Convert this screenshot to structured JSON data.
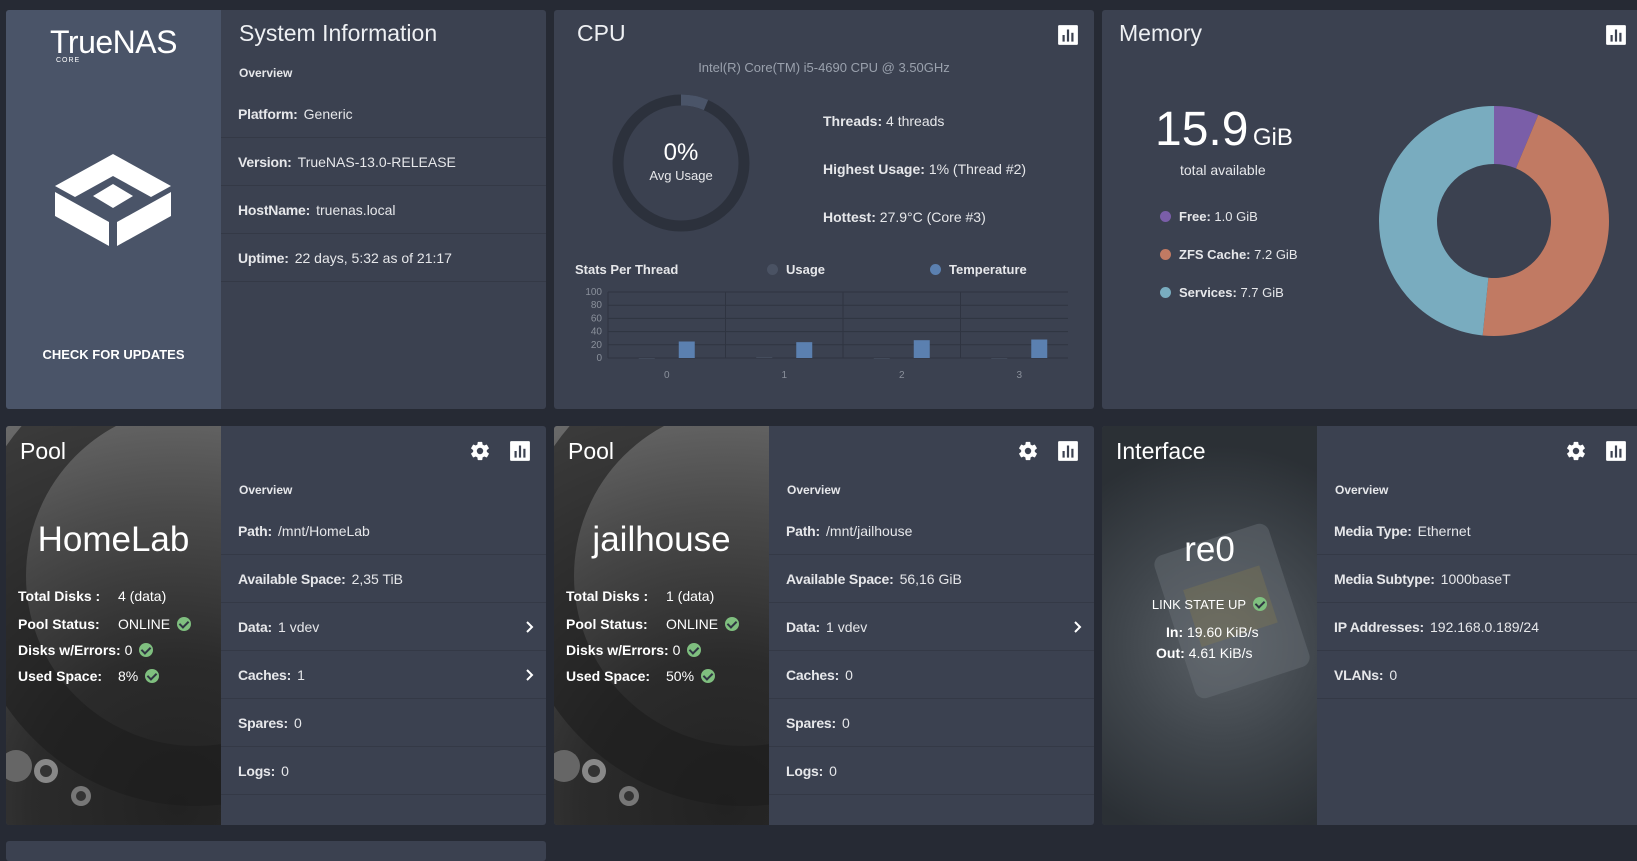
{
  "colors": {
    "card": "#3b4150",
    "accent_blue": "#5b80b0",
    "ok_green": "#7fbf7f",
    "free": "#7a5ea8",
    "zfs_cache": "#c17a63",
    "services": "#79acbf"
  },
  "sysinfo": {
    "brand": "TrueNAS",
    "brand_sub": "CORE",
    "check_updates": "CHECK FOR UPDATES",
    "title": "System Information",
    "overview": "Overview",
    "rows": [
      {
        "label": "Platform:",
        "value": "Generic"
      },
      {
        "label": "Version:",
        "value": "TrueNAS-13.0-RELEASE"
      },
      {
        "label": "HostName:",
        "value": "truenas.local"
      },
      {
        "label": "Uptime:",
        "value": "22 days, 5:32 as of 21:17"
      }
    ]
  },
  "cpu": {
    "title": "CPU",
    "model": "Intel(R) Core(TM) i5-4690 CPU @ 3.50GHz",
    "avg_value": "0%",
    "avg_label": "Avg Usage",
    "stats": [
      {
        "label": "Threads:",
        "value": "4 threads"
      },
      {
        "label": "Highest Usage:",
        "value": "1%  (Thread #2)"
      },
      {
        "label": "Hottest:",
        "value": "27.9°C  (Core #3)"
      }
    ],
    "stats_per_thread": "Stats Per Thread",
    "legend_usage": "Usage",
    "legend_temp": "Temperature"
  },
  "chart_data": {
    "type": "bar",
    "categories": [
      "0",
      "1",
      "2",
      "3"
    ],
    "series": [
      {
        "name": "Usage",
        "values": [
          0,
          1,
          0,
          0
        ],
        "color": "#4a5263"
      },
      {
        "name": "Temperature",
        "values": [
          25,
          24,
          27,
          28
        ],
        "color": "#5b80b0"
      }
    ],
    "yticks": [
      "100",
      "80",
      "60",
      "40",
      "20",
      "0"
    ],
    "ylim": [
      0,
      100
    ],
    "grid": true
  },
  "memory": {
    "title": "Memory",
    "total_value": "15.9",
    "total_unit": "GiB",
    "total_label": "total available",
    "legend": [
      {
        "label": "Free:",
        "value": "1.0 GiB",
        "gib": 1.0,
        "color": "#7a5ea8"
      },
      {
        "label": "ZFS Cache:",
        "value": "7.2 GiB",
        "gib": 7.2,
        "color": "#c17a63"
      },
      {
        "label": "Services:",
        "value": "7.7 GiB",
        "gib": 7.7,
        "color": "#79acbf"
      }
    ]
  },
  "pools": [
    {
      "title": "Pool",
      "name": "HomeLab",
      "total_disks_label": "Total Disks :",
      "total_disks": "4 (data)",
      "status_label": "Pool Status:",
      "status": "ONLINE",
      "errors_label": "Disks w/Errors:",
      "errors": "0",
      "used_label": "Used Space:",
      "used": "8%",
      "overview": "Overview",
      "rows": [
        {
          "label": "Path:",
          "value": "/mnt/HomeLab"
        },
        {
          "label": "Available Space:",
          "value": "2,35 TiB"
        },
        {
          "label": "Data:",
          "value": "1 vdev"
        },
        {
          "label": "Caches:",
          "value": "1"
        },
        {
          "label": "Spares:",
          "value": "0"
        },
        {
          "label": "Logs:",
          "value": "0"
        }
      ]
    },
    {
      "title": "Pool",
      "name": "jailhouse",
      "total_disks_label": "Total Disks :",
      "total_disks": "1 (data)",
      "status_label": "Pool Status:",
      "status": "ONLINE",
      "errors_label": "Disks w/Errors:",
      "errors": "0",
      "used_label": "Used Space:",
      "used": "50%",
      "overview": "Overview",
      "rows": [
        {
          "label": "Path:",
          "value": "/mnt/jailhouse"
        },
        {
          "label": "Available Space:",
          "value": "56,16 GiB"
        },
        {
          "label": "Data:",
          "value": "1 vdev"
        },
        {
          "label": "Caches:",
          "value": "0"
        },
        {
          "label": "Spares:",
          "value": "0"
        },
        {
          "label": "Logs:",
          "value": "0"
        }
      ]
    }
  ],
  "interface": {
    "title": "Interface",
    "name": "re0",
    "link_state": "LINK STATE UP",
    "in_label": "In:",
    "in_value": "19.60 KiB/s",
    "out_label": "Out:",
    "out_value": "4.61 KiB/s",
    "overview": "Overview",
    "rows": [
      {
        "label": "Media Type:",
        "value": "Ethernet"
      },
      {
        "label": "Media Subtype:",
        "value": "1000baseT"
      },
      {
        "label": "IP Addresses:",
        "value": "192.168.0.189/24"
      },
      {
        "label": "VLANs:",
        "value": "0"
      }
    ]
  },
  "icons": {
    "chart": "bar-chart-icon",
    "settings": "gear-icon",
    "chevron": "chevron-right-icon",
    "status_ok": "check-circle-icon",
    "logo": "truenas-logo-icon"
  }
}
